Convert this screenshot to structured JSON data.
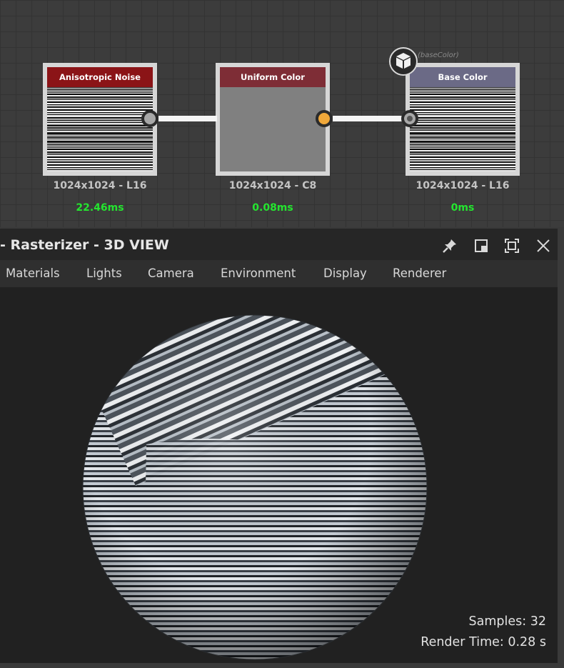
{
  "graph": {
    "nodes": [
      {
        "title": "Anisotropic Noise",
        "meta": "1024x1024 - L16",
        "time": "22.46ms",
        "header_color": "#8b1417"
      },
      {
        "title": "Uniform Color",
        "meta": "1024x1024 - C8",
        "time": "0.08ms",
        "header_color": "#7e2d36"
      },
      {
        "title": "Base Color",
        "meta": "1024x1024 - L16",
        "time": "0ms",
        "header_color": "#6b6a86"
      }
    ],
    "output_badge_icon": "cube-icon",
    "output_identifier": "(baseColor)"
  },
  "panel": {
    "title": "- Rasterizer - 3D VIEW",
    "controls": [
      "pin-icon",
      "restore-icon",
      "maximize-icon",
      "close-icon"
    ]
  },
  "menu": {
    "items": [
      "Materials",
      "Lights",
      "Camera",
      "Environment",
      "Display",
      "Renderer"
    ]
  },
  "viewport": {
    "samples": "Samples: 32",
    "render_time": "Render Time: 0.28 s"
  },
  "colors": {
    "time_green": "#24e52f",
    "port_orange": "#f0a83a",
    "graph_bg": "#3c3c3c"
  }
}
